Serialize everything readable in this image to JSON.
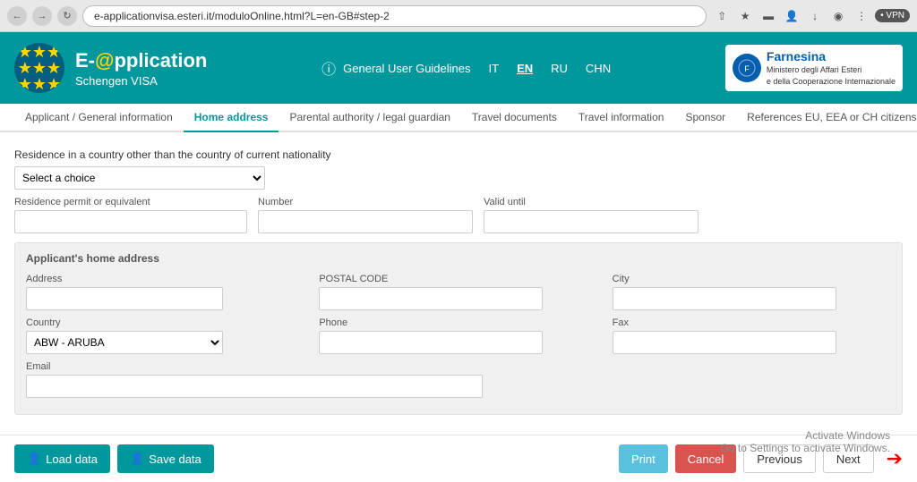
{
  "browser": {
    "address": "e-applicationvisa.esteri.it/moduloOnline.html?L=en-GB#step-2",
    "vpn_label": "• VPN"
  },
  "header": {
    "title_e": "E-",
    "title_at": "@",
    "title_pplication": "pplication",
    "subtitle": "Schengen VISA",
    "guidelines_label": "General User Guidelines",
    "lang_it": "IT",
    "lang_en": "EN",
    "lang_ru": "RU",
    "lang_chn": "CHN",
    "farnesina_title": "Farnesina",
    "farnesina_sub1": "Ministero degli Affari Esteri",
    "farnesina_sub2": "e della Cooperazione Internazionale"
  },
  "tabs": [
    {
      "label": "Applicant / General information",
      "active": false
    },
    {
      "label": "Home address",
      "active": true
    },
    {
      "label": "Parental authority / legal guardian",
      "active": false
    },
    {
      "label": "Travel documents",
      "active": false
    },
    {
      "label": "Travel information",
      "active": false
    },
    {
      "label": "Sponsor",
      "active": false
    },
    {
      "label": "References EU, EEA or CH citizens",
      "active": false
    }
  ],
  "form": {
    "residence_label": "Residence in a country other than the country of current nationality",
    "residence_placeholder": "Select a choice",
    "residence_permit_label": "Residence permit or equivalent",
    "number_label": "Number",
    "valid_until_label": "Valid until",
    "home_address_section": "Applicant's home address",
    "address_label": "Address",
    "postal_code_label": "POSTAL CODE",
    "city_label": "City",
    "country_label": "Country",
    "country_value": "ABW - ARUBA",
    "phone_label": "Phone",
    "fax_label": "Fax",
    "email_label": "Email"
  },
  "footer": {
    "load_data_label": "Load data",
    "save_data_label": "Save data",
    "print_label": "Print",
    "cancel_label": "Cancel",
    "previous_label": "Previous",
    "next_label": "Next"
  },
  "windows": {
    "line1": "Activate Windows",
    "line2": "Go to Settings to activate Windows."
  }
}
